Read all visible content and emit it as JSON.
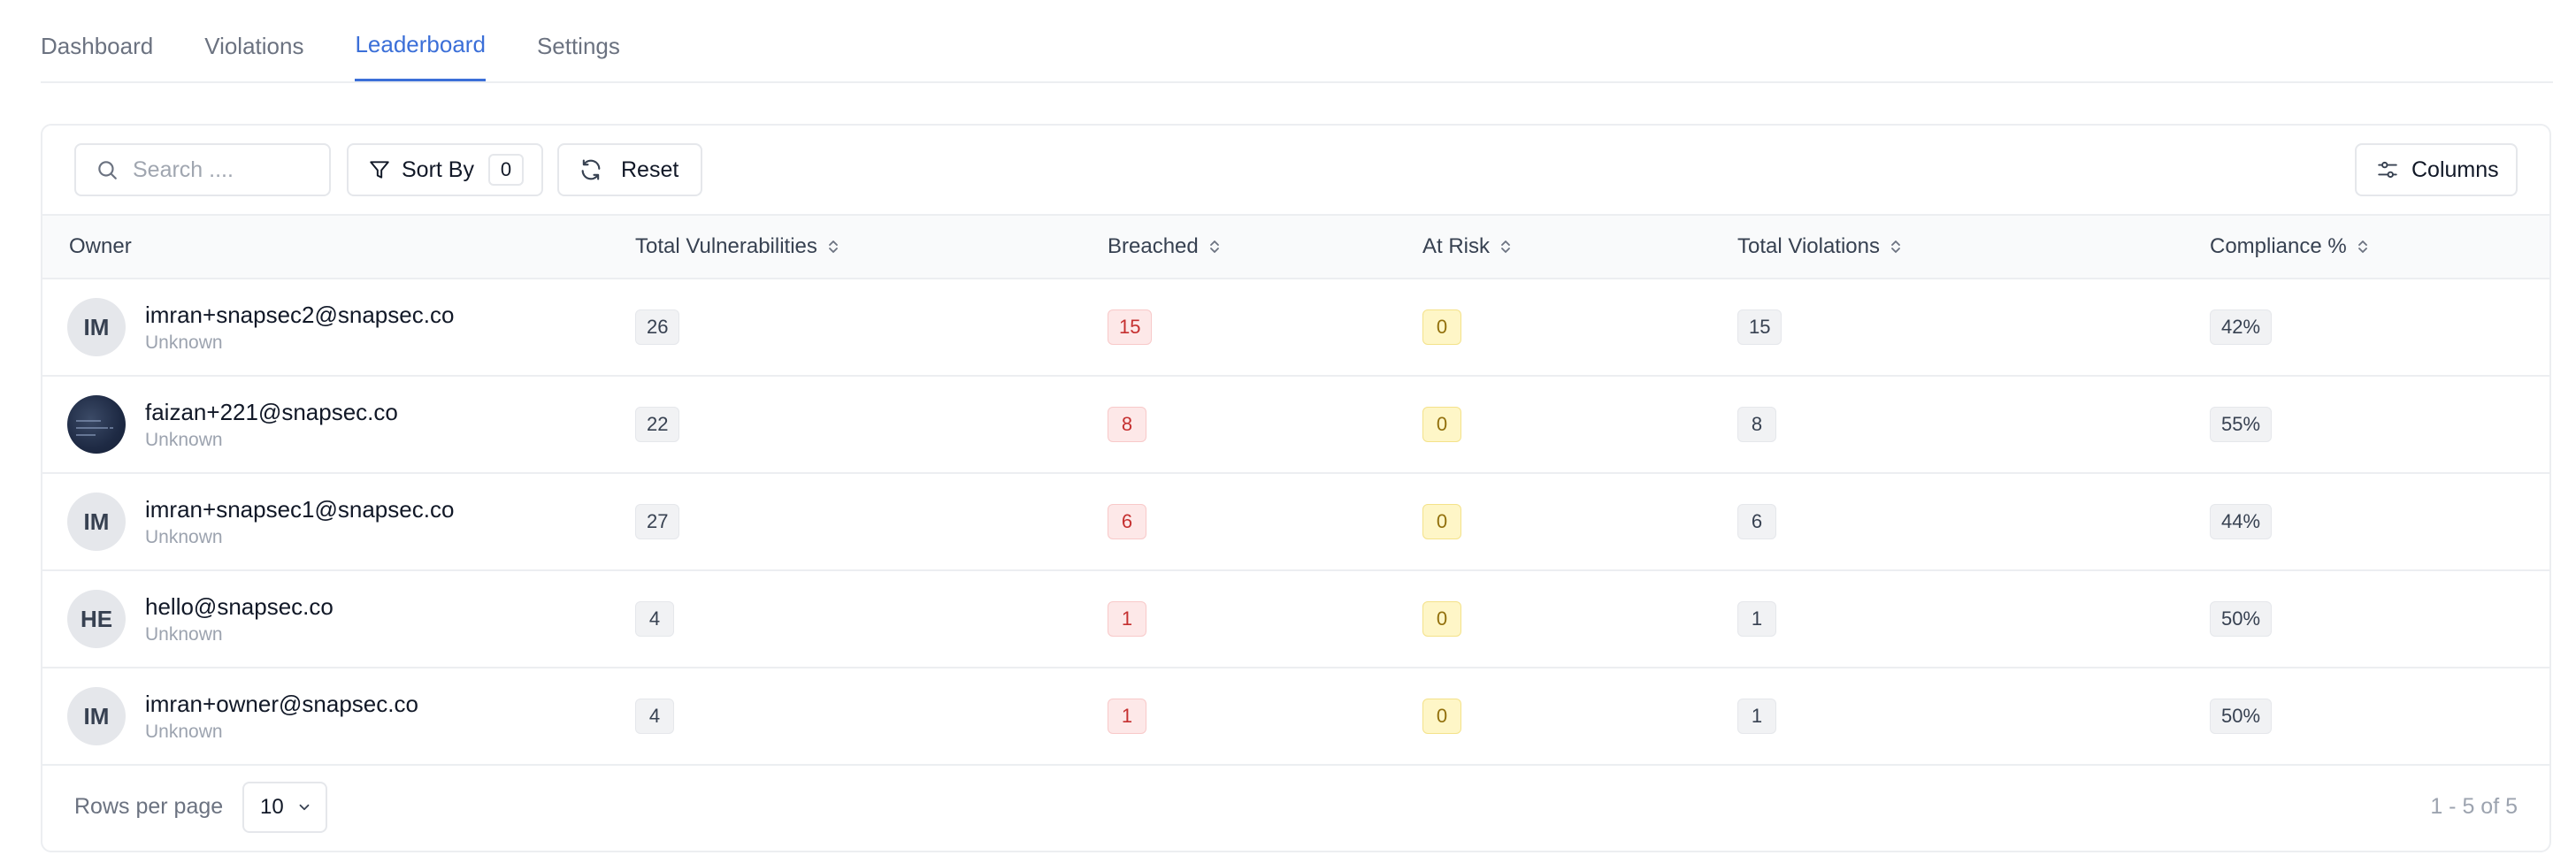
{
  "tabs": [
    {
      "label": "Dashboard",
      "active": false
    },
    {
      "label": "Violations",
      "active": false
    },
    {
      "label": "Leaderboard",
      "active": true
    },
    {
      "label": "Settings",
      "active": false
    }
  ],
  "toolbar": {
    "search_placeholder": "Search ....",
    "sort_label": "Sort By",
    "sort_count": "0",
    "reset_label": "Reset",
    "columns_label": "Columns"
  },
  "table": {
    "headers": [
      "Owner",
      "Total Vulnerabilities",
      "Breached",
      "At Risk",
      "Total Violations",
      "Compliance %"
    ],
    "rows": [
      {
        "initials": "IM",
        "email": "imran+snapsec2@snapsec.co",
        "sub": "Unknown",
        "vulns": "26",
        "breached": "15",
        "at_risk": "0",
        "violations": "15",
        "compliance": "42%"
      },
      {
        "initials": "",
        "email": "faizan+221@snapsec.co",
        "sub": "Unknown",
        "vulns": "22",
        "breached": "8",
        "at_risk": "0",
        "violations": "8",
        "compliance": "55%"
      },
      {
        "initials": "IM",
        "email": "imran+snapsec1@snapsec.co",
        "sub": "Unknown",
        "vulns": "27",
        "breached": "6",
        "at_risk": "0",
        "violations": "6",
        "compliance": "44%"
      },
      {
        "initials": "HE",
        "email": "hello@snapsec.co",
        "sub": "Unknown",
        "vulns": "4",
        "breached": "1",
        "at_risk": "0",
        "violations": "1",
        "compliance": "50%"
      },
      {
        "initials": "IM",
        "email": "imran+owner@snapsec.co",
        "sub": "Unknown",
        "vulns": "4",
        "breached": "1",
        "at_risk": "0",
        "violations": "1",
        "compliance": "50%"
      }
    ]
  },
  "footer": {
    "rows_per_page_label": "Rows per page",
    "rows_per_page_value": "10",
    "pagination": "1 - 5 of 5"
  },
  "colors": {
    "accent": "#3b6fd8",
    "breached_bg": "#fde8e8",
    "breached_text": "#c53030",
    "at_risk_bg": "#fef6c7",
    "at_risk_text": "#92700c"
  }
}
